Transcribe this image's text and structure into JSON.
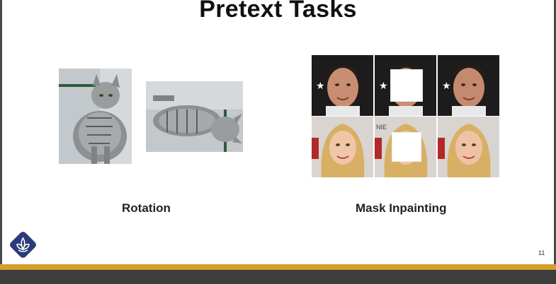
{
  "slide": {
    "title": "Pretext Tasks",
    "captions": {
      "rotation": "Rotation",
      "mask_inpainting": "Mask Inpainting"
    },
    "page_number": "11",
    "colors": {
      "accent_band": "#d59e2d",
      "logo": "#2b3a7a"
    }
  },
  "icons": {
    "logo": "lotus-logo-icon"
  }
}
